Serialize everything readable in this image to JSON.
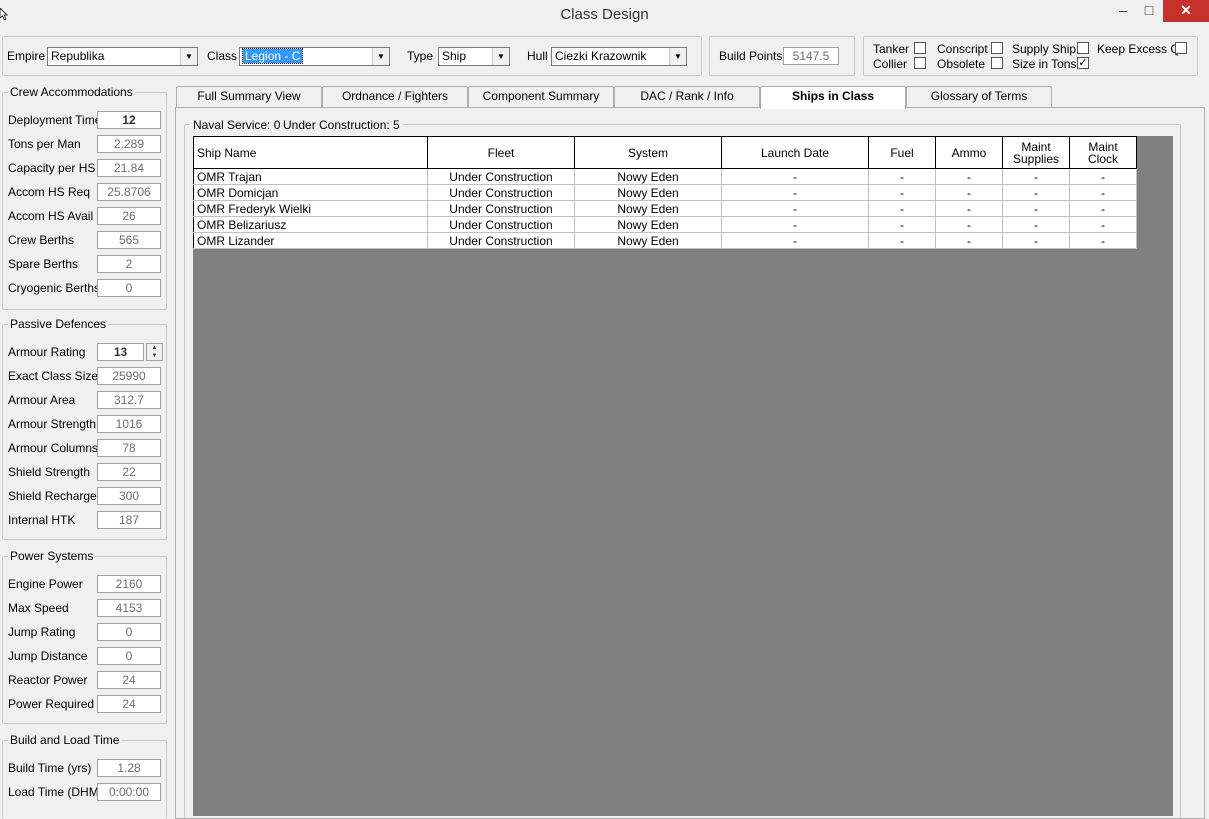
{
  "window": {
    "title": "Class Design",
    "minimize": "–",
    "maximize": "□",
    "close": "✕"
  },
  "top": {
    "empire_label": "Empire",
    "empire_value": "Republika",
    "class_label": "Class",
    "class_value": "Legion - C",
    "type_label": "Type",
    "type_value": "Ship",
    "hull_label": "Hull",
    "hull_value": "Ciezki Krazownik",
    "build_points_label": "Build Points",
    "build_points_value": "5147.5",
    "flags": [
      {
        "label": "Tanker",
        "checked": false
      },
      {
        "label": "Conscript",
        "checked": false
      },
      {
        "label": "Supply Ship",
        "checked": false
      },
      {
        "label": "Keep Excess Q",
        "checked": false
      },
      {
        "label": "Collier",
        "checked": false
      },
      {
        "label": "Obsolete",
        "checked": false
      },
      {
        "label": "Size in Tons",
        "checked": true
      }
    ]
  },
  "crew": {
    "legend": "Crew Accommodations",
    "rows": [
      {
        "label": "Deployment Time",
        "value": "12"
      },
      {
        "label": "Tons per Man",
        "value": "2.289"
      },
      {
        "label": "Capacity per HS",
        "value": "21.84"
      },
      {
        "label": "Accom HS Req",
        "value": "25.8706"
      },
      {
        "label": "Accom HS Avail",
        "value": "26"
      },
      {
        "label": "Crew Berths",
        "value": "565"
      },
      {
        "label": "Spare Berths",
        "value": "2"
      },
      {
        "label": "Cryogenic Berths",
        "value": "0"
      }
    ]
  },
  "passive": {
    "legend": "Passive Defences",
    "rows": [
      {
        "label": "Armour Rating",
        "value": "13"
      },
      {
        "label": "Exact Class Size",
        "value": "25990"
      },
      {
        "label": "Armour Area",
        "value": "312.7"
      },
      {
        "label": "Armour Strength",
        "value": "1016"
      },
      {
        "label": "Armour Columns",
        "value": "78"
      },
      {
        "label": "Shield Strength",
        "value": "22"
      },
      {
        "label": "Shield Recharge",
        "value": "300"
      },
      {
        "label": "Internal HTK",
        "value": "187"
      }
    ]
  },
  "power": {
    "legend": "Power Systems",
    "rows": [
      {
        "label": "Engine Power",
        "value": "2160"
      },
      {
        "label": "Max Speed",
        "value": "4153"
      },
      {
        "label": "Jump Rating",
        "value": "0"
      },
      {
        "label": "Jump Distance",
        "value": "0"
      },
      {
        "label": "Reactor Power",
        "value": "24"
      },
      {
        "label": "Power Required",
        "value": "24"
      }
    ]
  },
  "build": {
    "legend": "Build and Load Time",
    "rows": [
      {
        "label": "Build Time (yrs)",
        "value": "1.28"
      },
      {
        "label": "Load Time (DHM)",
        "value": "0:00:00"
      }
    ]
  },
  "tabs": [
    "Full Summary View",
    "Ordnance / Fighters",
    "Component Summary",
    "DAC / Rank / Info",
    "Ships in Class",
    "Glossary of Terms"
  ],
  "active_tab": "Ships in Class",
  "ships": {
    "naval_service": "Naval Service: 0",
    "under_construction": "Under Construction: 5",
    "columns": [
      "Ship Name",
      "Fleet",
      "System",
      "Launch Date",
      "Fuel",
      "Ammo",
      "Maint Supplies",
      "Maint Clock"
    ],
    "rows": [
      [
        "OMR Trajan",
        "Under Construction",
        "Nowy Eden",
        "-",
        "-",
        "-",
        "-",
        "-"
      ],
      [
        "OMR Domicjan",
        "Under Construction",
        "Nowy Eden",
        "-",
        "-",
        "-",
        "-",
        "-"
      ],
      [
        "OMR Frederyk Wielki",
        "Under Construction",
        "Nowy Eden",
        "-",
        "-",
        "-",
        "-",
        "-"
      ],
      [
        "OMR Belizariusz",
        "Under Construction",
        "Nowy Eden",
        "-",
        "-",
        "-",
        "-",
        "-"
      ],
      [
        "OMR Lizander",
        "Under Construction",
        "Nowy Eden",
        "-",
        "-",
        "-",
        "-",
        "-"
      ]
    ]
  }
}
